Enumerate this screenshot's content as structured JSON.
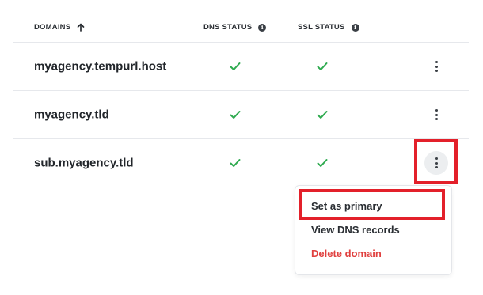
{
  "table": {
    "headers": {
      "domains": "DOMAINS",
      "dns_status": "DNS STATUS",
      "ssl_status": "SSL STATUS"
    },
    "rows": [
      {
        "domain": "myagency.tempurl.host",
        "dns_ok": true,
        "ssl_ok": true
      },
      {
        "domain": "myagency.tld",
        "dns_ok": true,
        "ssl_ok": true
      },
      {
        "domain": "sub.myagency.tld",
        "dns_ok": true,
        "ssl_ok": true
      }
    ]
  },
  "menu": {
    "items": [
      {
        "label": "Set as primary"
      },
      {
        "label": "View DNS records"
      },
      {
        "label": "Delete domain"
      }
    ]
  },
  "icons": {
    "sort": "arrow-up-icon",
    "info": "info-icon",
    "status_ok": "check-icon",
    "row_menu": "kebab-menu-icon"
  },
  "colors": {
    "check_green": "#2eaa4f",
    "danger_red": "#e0403f",
    "highlight_red": "#e3202a",
    "divider": "#e6e8ec"
  }
}
